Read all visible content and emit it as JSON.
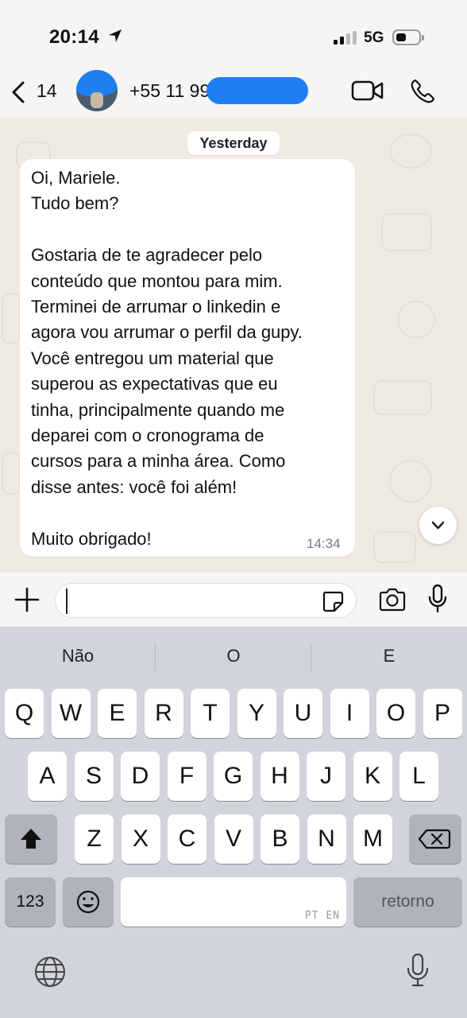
{
  "status_bar": {
    "time": "20:14",
    "network": "5G"
  },
  "header": {
    "unread_count": "14",
    "contact_number": "+55 11 99"
  },
  "chat": {
    "date_label": "Yesterday",
    "message": {
      "lines": [
        "Oi, Mariele.",
        "Tudo bem?",
        "",
        "Gostaria de te agradecer pelo",
        "conteúdo que montou para mim.",
        "Terminei de arrumar o linkedin e",
        "agora vou arrumar o perfil da gupy.",
        "Você entregou um material que",
        "superou as expectativas que eu",
        "tinha, principalmente quando me",
        "deparei com o cronograma de",
        "cursos para a minha área. Como",
        "disse antes: você foi além!",
        "",
        "Muito obrigado!"
      ],
      "time": "14:34"
    }
  },
  "keyboard": {
    "suggestions": [
      "Não",
      "O",
      "E"
    ],
    "row1": [
      "Q",
      "W",
      "E",
      "R",
      "T",
      "Y",
      "U",
      "I",
      "O",
      "P"
    ],
    "row2": [
      "A",
      "S",
      "D",
      "F",
      "G",
      "H",
      "J",
      "K",
      "L"
    ],
    "row3": [
      "Z",
      "X",
      "C",
      "V",
      "B",
      "N",
      "M"
    ],
    "numbers_key": "123",
    "space_hint": "PT EN",
    "return_key": "retorno"
  },
  "icons": [
    "location-arrow-icon",
    "signal-icon",
    "battery-icon",
    "back-chevron-icon",
    "video-call-icon",
    "phone-icon",
    "chevron-down-icon",
    "plus-icon",
    "sticker-icon",
    "camera-icon",
    "microphone-icon",
    "shift-icon",
    "backspace-icon",
    "emoji-icon",
    "globe-icon"
  ]
}
